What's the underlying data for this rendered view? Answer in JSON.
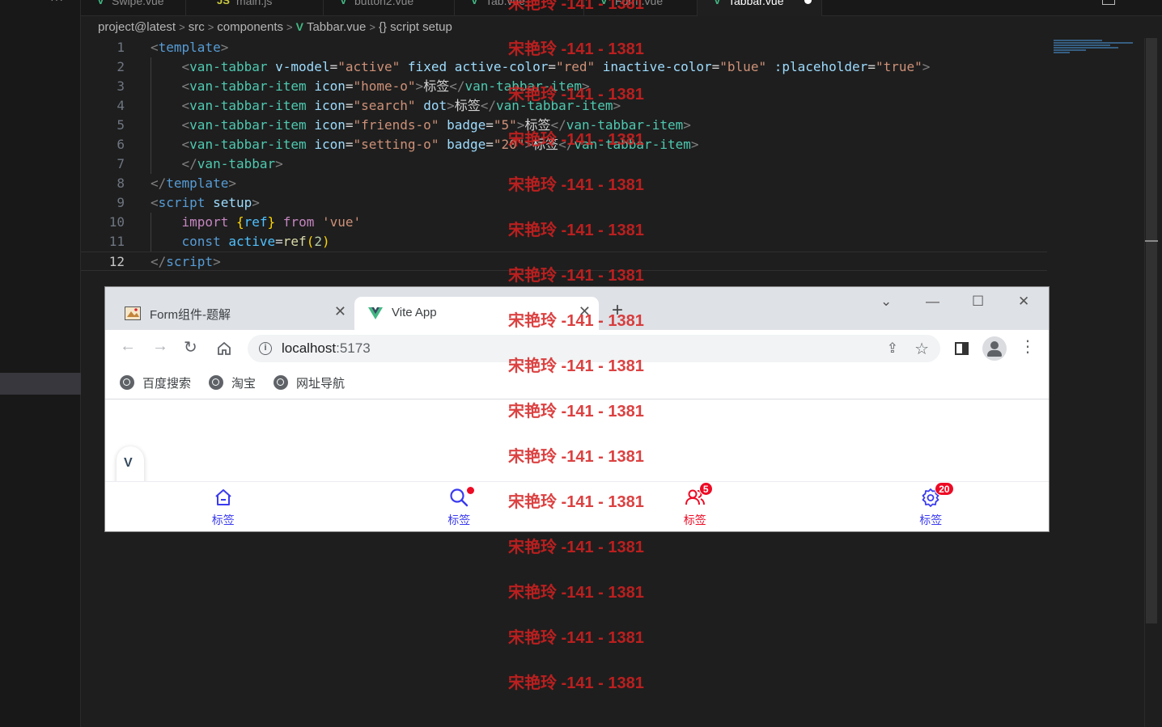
{
  "vscode": {
    "tabs": [
      {
        "label": "Swipe.vue",
        "icon": "vue-icon"
      },
      {
        "label": "main.js",
        "icon": "js-icon"
      },
      {
        "label": "button2.vue",
        "icon": "vue-icon"
      },
      {
        "label": "Tab.vue",
        "icon": "vue-icon"
      },
      {
        "label": "Form.vue",
        "icon": "vue-icon"
      },
      {
        "label": "Tabbar.vue",
        "icon": "vue-icon",
        "active": true
      }
    ],
    "breadcrumb": [
      "project@latest",
      "src",
      "components",
      "Tabbar.vue",
      "{} script setup"
    ],
    "code": {
      "line_numbers": [
        "1",
        "2",
        "3",
        "4",
        "5",
        "6",
        "7",
        "8",
        "9",
        "10",
        "11",
        "12"
      ],
      "current_line": "12",
      "lines": [
        [
          [
            "tg",
            "<"
          ],
          [
            "tn",
            "template"
          ],
          [
            "tg",
            ">"
          ]
        ],
        [
          [
            "tx",
            "    "
          ],
          [
            "tg",
            "<"
          ],
          [
            "cn",
            "van-tabbar"
          ],
          [
            "tx",
            " "
          ],
          [
            "at",
            "v-model"
          ],
          [
            "tx",
            "="
          ],
          [
            "st",
            "\"active\""
          ],
          [
            "tx",
            " "
          ],
          [
            "at",
            "fixed"
          ],
          [
            "tx",
            " "
          ],
          [
            "at",
            "active-color"
          ],
          [
            "tx",
            "="
          ],
          [
            "st",
            "\"red\""
          ],
          [
            "tx",
            " "
          ],
          [
            "at",
            "inactive-color"
          ],
          [
            "tx",
            "="
          ],
          [
            "st",
            "\"blue\""
          ],
          [
            "tx",
            " "
          ],
          [
            "at",
            ":placeholder"
          ],
          [
            "tx",
            "="
          ],
          [
            "st",
            "\"true\""
          ],
          [
            "tg",
            ">"
          ]
        ],
        [
          [
            "tx",
            "    "
          ],
          [
            "tg",
            "<"
          ],
          [
            "cn",
            "van-tabbar-item"
          ],
          [
            "tx",
            " "
          ],
          [
            "at",
            "icon"
          ],
          [
            "tx",
            "="
          ],
          [
            "st",
            "\"home-o\""
          ],
          [
            "tg",
            ">"
          ],
          [
            "tx",
            "标签"
          ],
          [
            "tg",
            "</"
          ],
          [
            "cn",
            "van-tabbar-item"
          ],
          [
            "tg",
            ">"
          ]
        ],
        [
          [
            "tx",
            "    "
          ],
          [
            "tg",
            "<"
          ],
          [
            "cn",
            "van-tabbar-item"
          ],
          [
            "tx",
            " "
          ],
          [
            "at",
            "icon"
          ],
          [
            "tx",
            "="
          ],
          [
            "st",
            "\"search\""
          ],
          [
            "tx",
            " "
          ],
          [
            "at",
            "dot"
          ],
          [
            "tg",
            ">"
          ],
          [
            "tx",
            "标签"
          ],
          [
            "tg",
            "</"
          ],
          [
            "cn",
            "van-tabbar-item"
          ],
          [
            "tg",
            ">"
          ]
        ],
        [
          [
            "tx",
            "    "
          ],
          [
            "tg",
            "<"
          ],
          [
            "cn",
            "van-tabbar-item"
          ],
          [
            "tx",
            " "
          ],
          [
            "at",
            "icon"
          ],
          [
            "tx",
            "="
          ],
          [
            "st",
            "\"friends-o\""
          ],
          [
            "tx",
            " "
          ],
          [
            "at",
            "badge"
          ],
          [
            "tx",
            "="
          ],
          [
            "st",
            "\"5\""
          ],
          [
            "tg",
            ">"
          ],
          [
            "tx",
            "标签"
          ],
          [
            "tg",
            "</"
          ],
          [
            "cn",
            "van-tabbar-item"
          ],
          [
            "tg",
            ">"
          ]
        ],
        [
          [
            "tx",
            "    "
          ],
          [
            "tg",
            "<"
          ],
          [
            "cn",
            "van-tabbar-item"
          ],
          [
            "tx",
            " "
          ],
          [
            "at",
            "icon"
          ],
          [
            "tx",
            "="
          ],
          [
            "st",
            "\"setting-o\""
          ],
          [
            "tx",
            " "
          ],
          [
            "at",
            "badge"
          ],
          [
            "tx",
            "="
          ],
          [
            "st",
            "\"20\""
          ],
          [
            "tg",
            ">"
          ],
          [
            "tx",
            "标签"
          ],
          [
            "tg",
            "</"
          ],
          [
            "cn",
            "van-tabbar-item"
          ],
          [
            "tg",
            ">"
          ]
        ],
        [
          [
            "tx",
            "    "
          ],
          [
            "tg",
            "</"
          ],
          [
            "cn",
            "van-tabbar"
          ],
          [
            "tg",
            ">"
          ]
        ],
        [
          [
            "tg",
            "</"
          ],
          [
            "tn",
            "template"
          ],
          [
            "tg",
            ">"
          ]
        ],
        [
          [
            "tg",
            "<"
          ],
          [
            "tn",
            "script"
          ],
          [
            "tx",
            " "
          ],
          [
            "at",
            "setup"
          ],
          [
            "tg",
            ">"
          ]
        ],
        [
          [
            "tx",
            "    "
          ],
          [
            "kw",
            "import"
          ],
          [
            "tx",
            " "
          ],
          [
            "br",
            "{"
          ],
          [
            "vr",
            "ref"
          ],
          [
            "br",
            "}"
          ],
          [
            "tx",
            " "
          ],
          [
            "kw",
            "from"
          ],
          [
            "tx",
            " "
          ],
          [
            "st",
            "'vue'"
          ]
        ],
        [
          [
            "tx",
            "    "
          ],
          [
            "kb",
            "const"
          ],
          [
            "tx",
            " "
          ],
          [
            "vr",
            "active"
          ],
          [
            "tx",
            "="
          ],
          [
            "fn",
            "ref"
          ],
          [
            "br",
            "("
          ],
          [
            "nm",
            "2"
          ],
          [
            "br",
            ")"
          ]
        ],
        [
          [
            "tg",
            "</"
          ],
          [
            "tn",
            "script"
          ],
          [
            "tg",
            ">"
          ]
        ]
      ]
    }
  },
  "browser": {
    "tabs": [
      {
        "title": "Form组件-题解",
        "icon": "site-favicon",
        "active": false
      },
      {
        "title": "Vite App",
        "icon": "vite-favicon",
        "active": true
      }
    ],
    "new_tab": "+",
    "url": {
      "host": "localhost",
      "port": ":5173"
    },
    "bookmarks": [
      "百度搜索",
      "淘宝",
      "网址导航"
    ]
  },
  "tabbar": {
    "active_color": "#ee0a24",
    "inactive_color": "#1989fa",
    "active_index": 2,
    "items": [
      {
        "icon": "home-o-icon",
        "label": "标签"
      },
      {
        "icon": "search-icon",
        "label": "标签",
        "dot": true
      },
      {
        "icon": "friends-o-icon",
        "label": "标签",
        "badge": "5"
      },
      {
        "icon": "setting-o-icon",
        "label": "标签",
        "badge": "20"
      }
    ]
  },
  "watermark": {
    "text": "宋艳玲 -141 - 1381",
    "count": 16
  }
}
